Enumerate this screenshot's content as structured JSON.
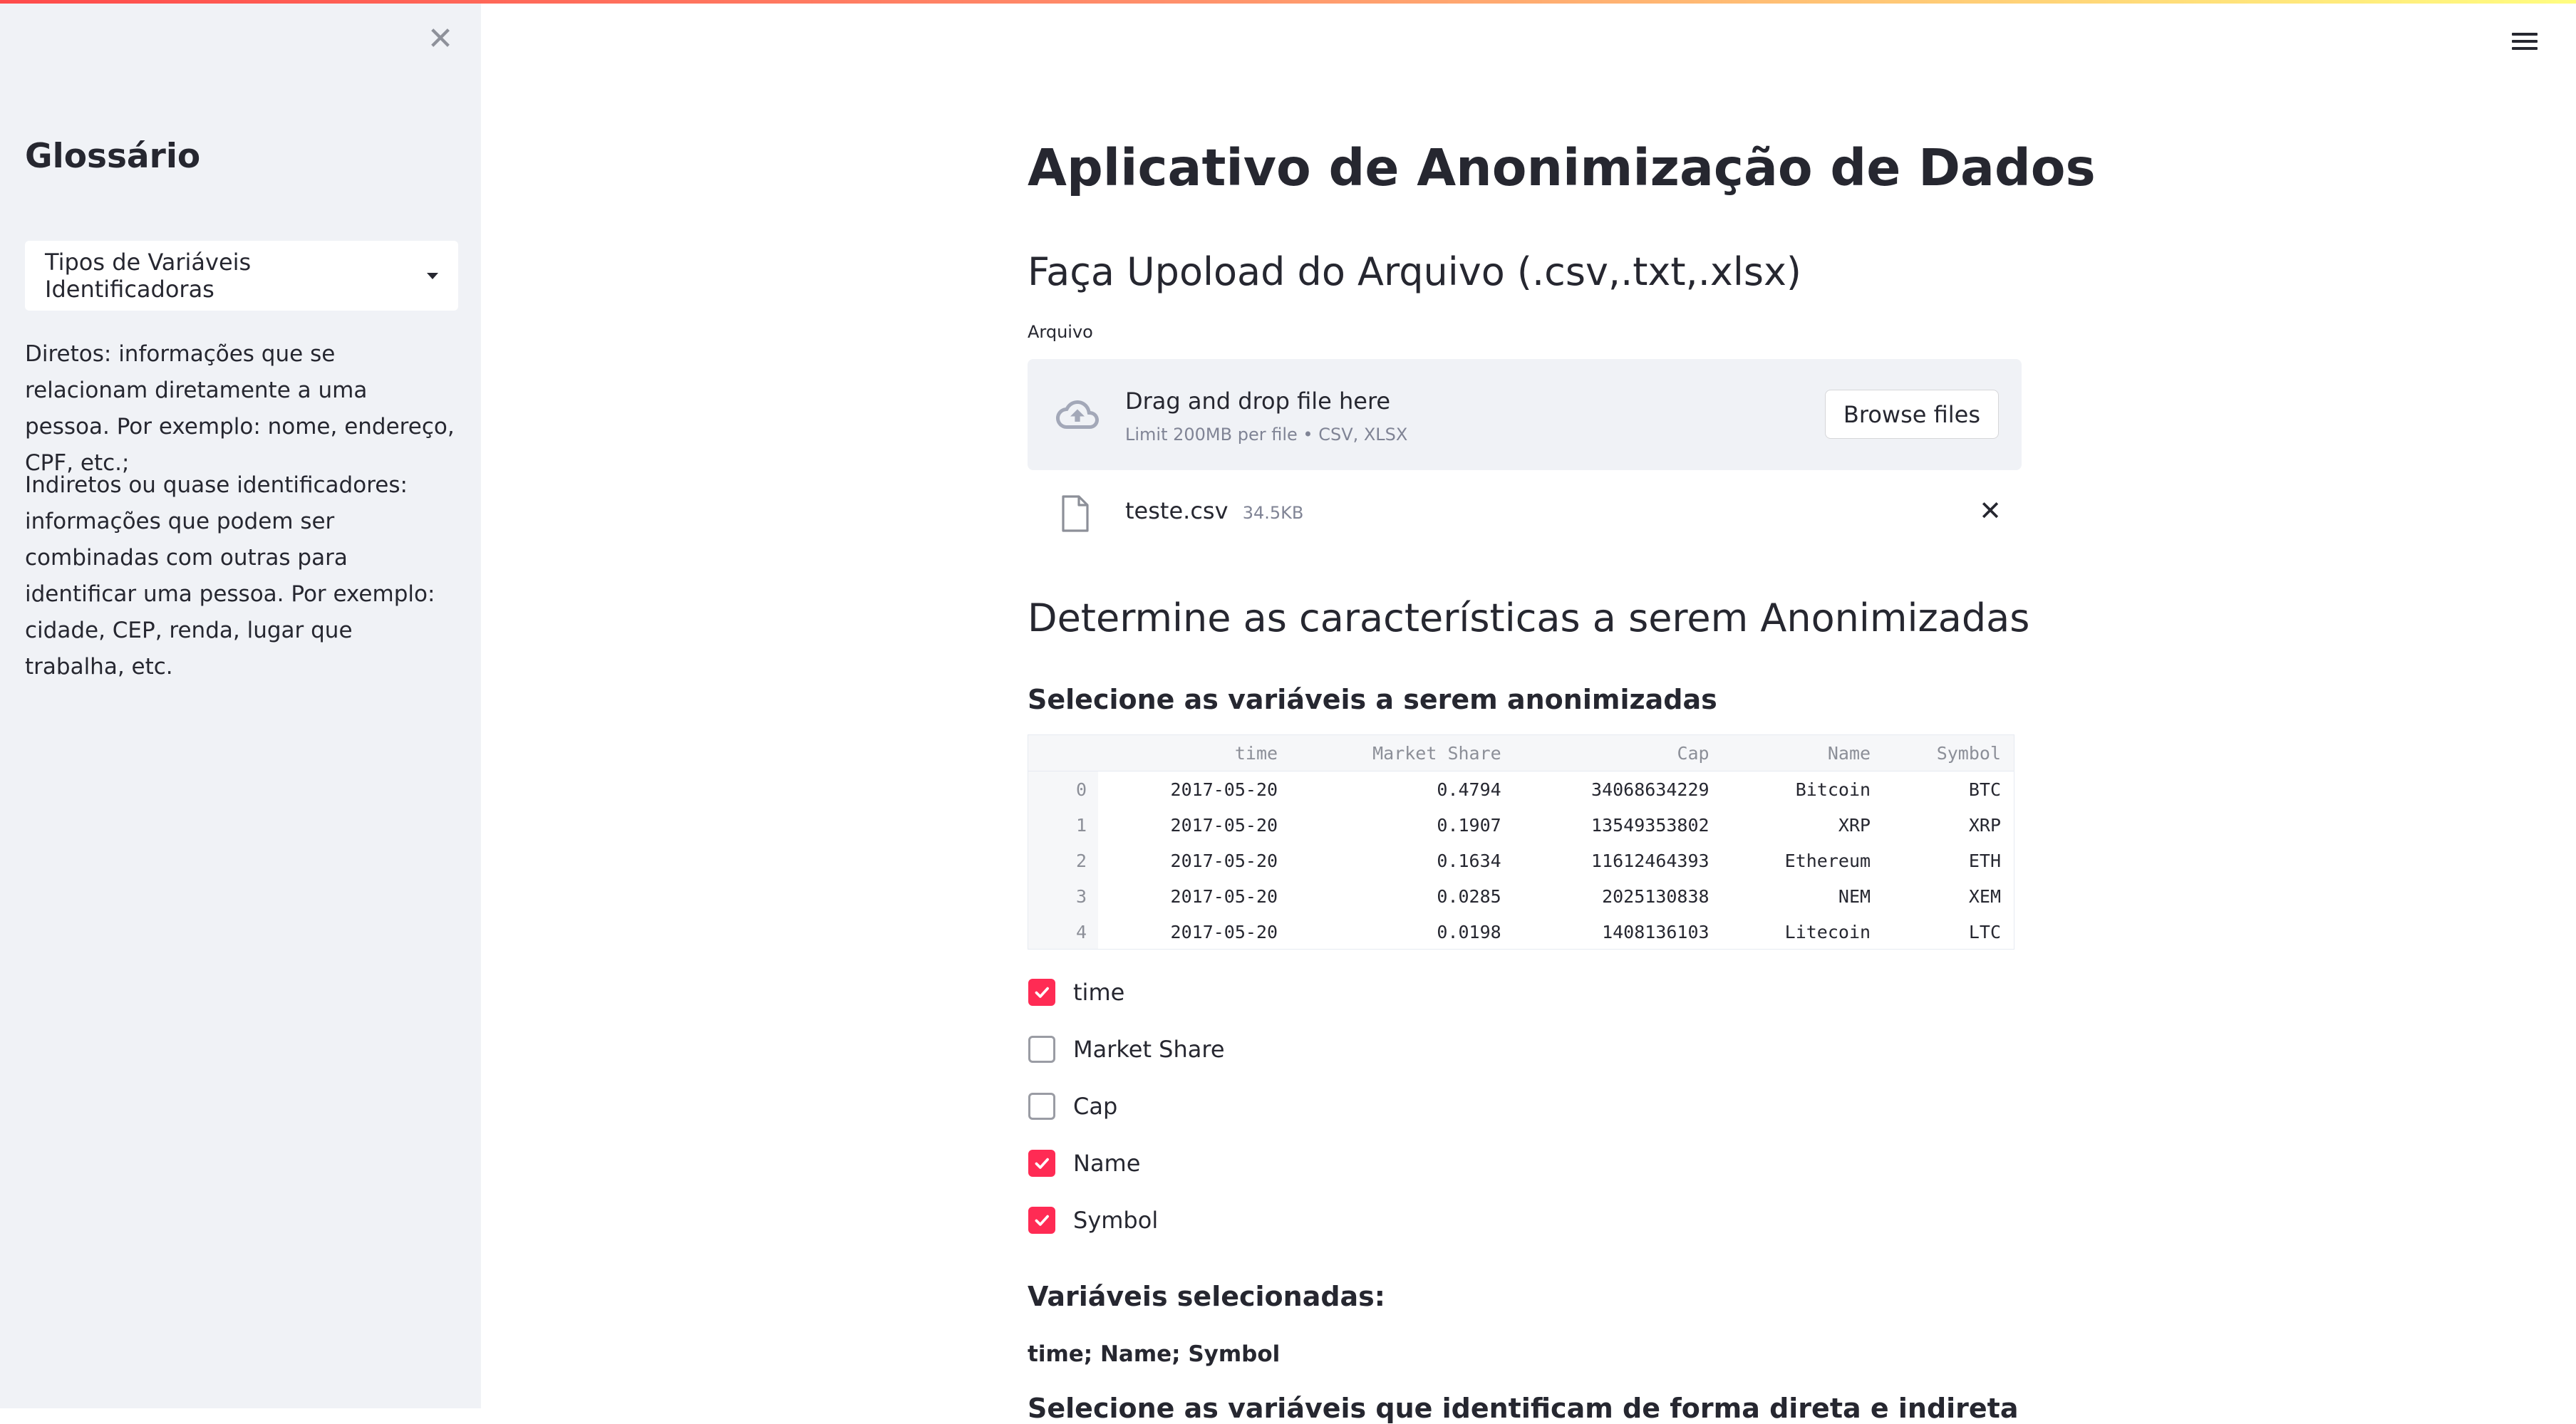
{
  "sidebar": {
    "title": "Glossário",
    "select": {
      "value": "Tipos de Variáveis Identificadoras"
    },
    "paragraphs": [
      "Diretos: informações que se relacionam diretamente a uma pessoa. Por exemplo: nome, endereço, CPF, etc.;",
      "Indiretos ou quase identificadores: informações que podem ser combinadas com outras para identificar uma pessoa. Por exemplo: cidade, CEP, renda, lugar que trabalha, etc."
    ]
  },
  "main": {
    "title": "Aplicativo de Anonimização de Dados",
    "upload": {
      "heading": "Faça Upoload do Arquivo (.csv,.txt,.xlsx)",
      "label": "Arquivo",
      "drag_text": "Drag and drop file here",
      "limit_text": "Limit 200MB per file • CSV, XLSX",
      "browse_label": "Browse files",
      "file": {
        "name": "teste.csv",
        "size": "34.5KB"
      }
    },
    "section_heading": "Determine as características a serem Anonimizadas",
    "select_heading": "Selecione as variáveis a serem anonimizadas",
    "table": {
      "columns": [
        "time",
        "Market Share",
        "Cap",
        "Name",
        "Symbol"
      ],
      "rows": [
        [
          "0",
          "2017-05-20",
          "0.4794",
          "34068634229",
          "Bitcoin",
          "BTC"
        ],
        [
          "1",
          "2017-05-20",
          "0.1907",
          "13549353802",
          "XRP",
          "XRP"
        ],
        [
          "2",
          "2017-05-20",
          "0.1634",
          "11612464393",
          "Ethereum",
          "ETH"
        ],
        [
          "3",
          "2017-05-20",
          "0.0285",
          "2025130838",
          "NEM",
          "XEM"
        ],
        [
          "4",
          "2017-05-20",
          "0.0198",
          "1408136103",
          "Litecoin",
          "LTC"
        ]
      ]
    },
    "checkboxes": [
      {
        "label": "time",
        "checked": true
      },
      {
        "label": "Market Share",
        "checked": false
      },
      {
        "label": "Cap",
        "checked": false
      },
      {
        "label": "Name",
        "checked": true
      },
      {
        "label": "Symbol",
        "checked": true
      }
    ],
    "selected_heading": "Variáveis selecionadas:",
    "selected_value": "time; Name; Symbol",
    "next_heading": "Selecione as variáveis que identificam de forma direta e indireta"
  },
  "colors": {
    "accent": "#ff2b54",
    "sidebar_bg": "#f0f2f6",
    "text": "#262730"
  },
  "icons": {
    "close": "close-icon",
    "menu": "hamburger-icon",
    "upload": "cloud-upload-icon",
    "file": "file-icon"
  }
}
